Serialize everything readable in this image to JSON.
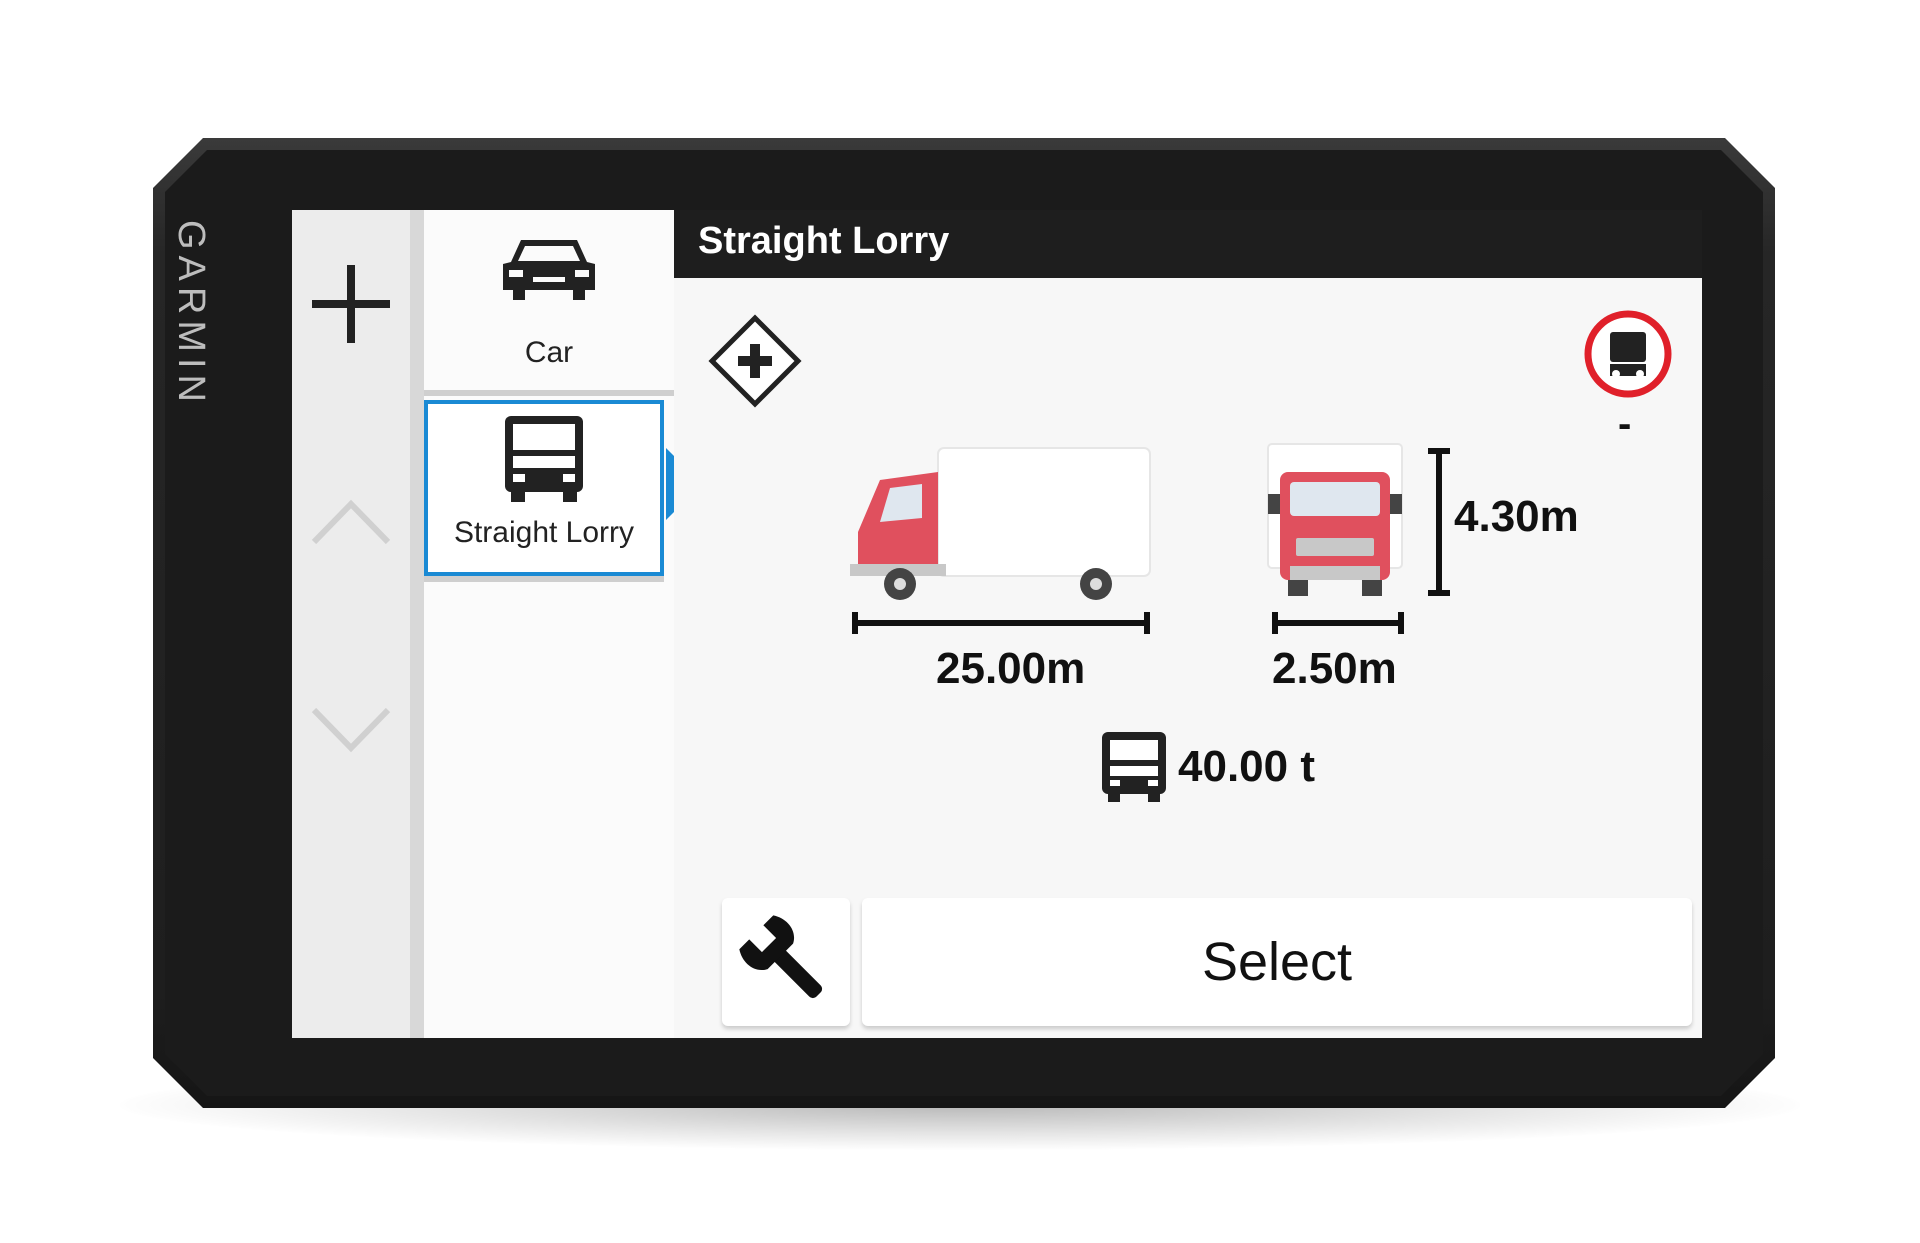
{
  "device": {
    "brand": "GARMIN"
  },
  "header": {
    "title": "Straight Lorry"
  },
  "profiles": [
    {
      "label": "Car",
      "icon": "car-icon",
      "selected": false
    },
    {
      "label": "Straight Lorry",
      "icon": "lorry-icon",
      "selected": true
    }
  ],
  "dimensions": {
    "length": "25.00m",
    "width": "2.50m",
    "height": "4.30m",
    "weight": "40.00 t",
    "axle_restriction": "-"
  },
  "buttons": {
    "select_label": "Select"
  },
  "colors": {
    "accent": "#1a8ad4",
    "vehicle": "#e0505e",
    "restriction": "#e0202a"
  }
}
